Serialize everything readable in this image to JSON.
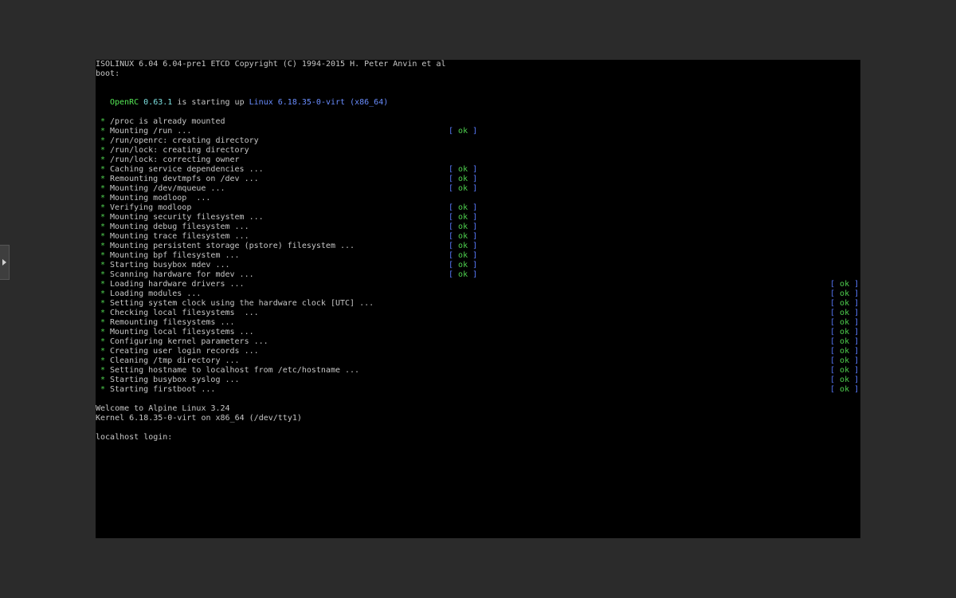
{
  "header": [
    "ISOLINUX 6.04 6.04-pre1 ETCD Copyright (C) 1994-2015 H. Peter Anvin et al",
    "boot:"
  ],
  "openrc": {
    "name": "OpenRC",
    "version": "0.63.1",
    "middle": "is starting up",
    "kernel": "Linux 6.18.35-0-virt (x86_64)"
  },
  "bullet_glyph": "*",
  "ok_label": "ok",
  "services": [
    {
      "text": "/proc is already mounted",
      "status": ""
    },
    {
      "text": "Mounting /run ...",
      "status": "mid"
    },
    {
      "text": "/run/openrc: creating directory",
      "status": ""
    },
    {
      "text": "/run/lock: creating directory",
      "status": ""
    },
    {
      "text": "/run/lock: correcting owner",
      "status": ""
    },
    {
      "text": "Caching service dependencies ...",
      "status": "mid"
    },
    {
      "text": "Remounting devtmpfs on /dev ...",
      "status": "mid"
    },
    {
      "text": "Mounting /dev/mqueue ...",
      "status": "mid"
    },
    {
      "text": "Mounting modloop  ...",
      "status": ""
    },
    {
      "text": "Verifying modloop",
      "status": "mid"
    },
    {
      "text": "Mounting security filesystem ...",
      "status": "mid"
    },
    {
      "text": "Mounting debug filesystem ...",
      "status": "mid"
    },
    {
      "text": "Mounting trace filesystem ...",
      "status": "mid"
    },
    {
      "text": "Mounting persistent storage (pstore) filesystem ...",
      "status": "mid"
    },
    {
      "text": "Mounting bpf filesystem ...",
      "status": "mid"
    },
    {
      "text": "Starting busybox mdev ...",
      "status": "mid"
    },
    {
      "text": "Scanning hardware for mdev ...",
      "status": "mid"
    },
    {
      "text": "Loading hardware drivers ...",
      "status": "far"
    },
    {
      "text": "Loading modules ...",
      "status": "far"
    },
    {
      "text": "Setting system clock using the hardware clock [UTC] ...",
      "status": "far"
    },
    {
      "text": "Checking local filesystems  ...",
      "status": "far"
    },
    {
      "text": "Remounting filesystems ...",
      "status": "far"
    },
    {
      "text": "Mounting local filesystems ...",
      "status": "far"
    },
    {
      "text": "Configuring kernel parameters ...",
      "status": "far"
    },
    {
      "text": "Creating user login records ...",
      "status": "far"
    },
    {
      "text": "Cleaning /tmp directory ...",
      "status": "far"
    },
    {
      "text": "Setting hostname to localhost from /etc/hostname ...",
      "status": "far"
    },
    {
      "text": "Starting busybox syslog ...",
      "status": "far"
    },
    {
      "text": "Starting firstboot ...",
      "status": "far"
    }
  ],
  "welcome": "Welcome to Alpine Linux 3.24",
  "kernel_line": "Kernel 6.18.35-0-virt on x86_64 (/dev/tty1)",
  "login_prompt": "localhost login:"
}
